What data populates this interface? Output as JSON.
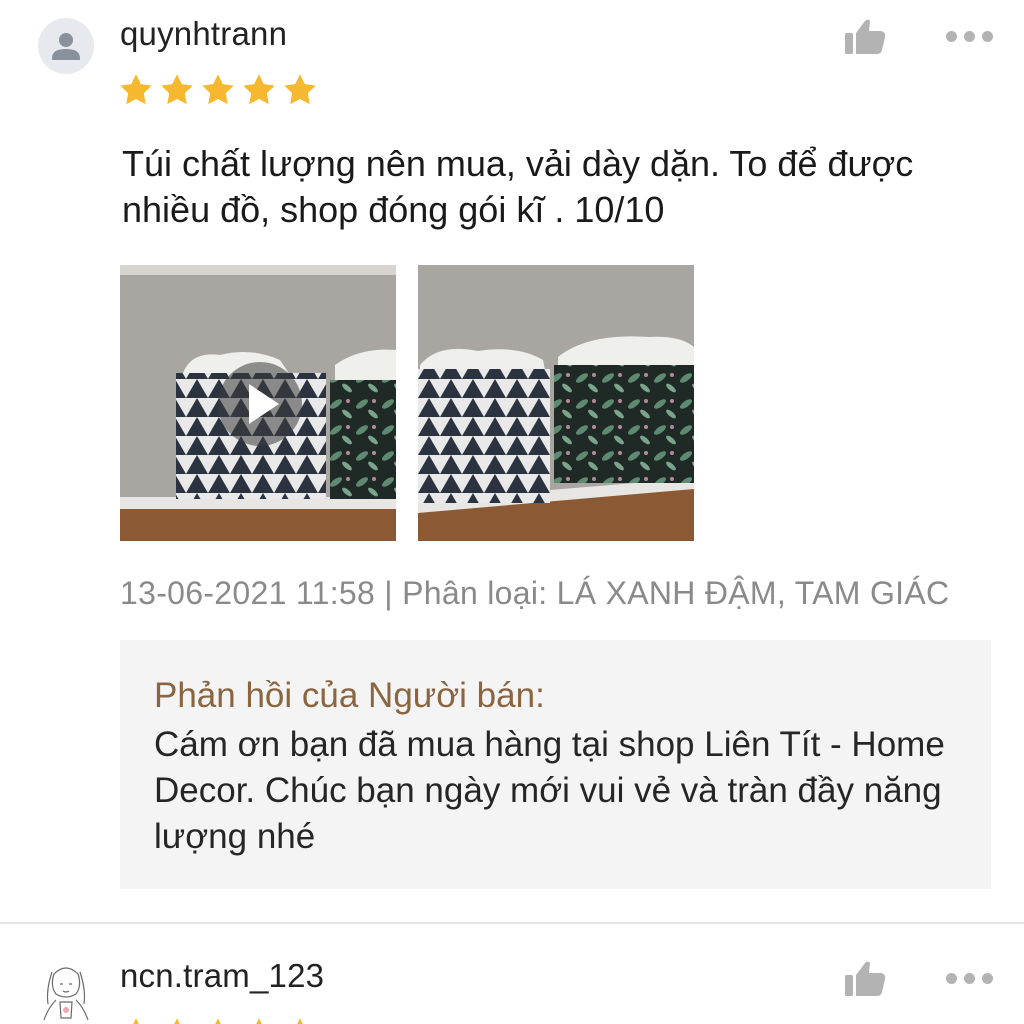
{
  "reviews": [
    {
      "username": "quynhtrann",
      "avatar_icon": "default-user-icon",
      "rating": 5,
      "text": "Túi chất lượng nên mua, vải dày dặn. To để được nhiều đồ, shop đóng gói kĩ . 10/10",
      "media": [
        {
          "type": "video",
          "icon": "play-icon"
        },
        {
          "type": "image"
        }
      ],
      "date": "13-06-2021 11:58",
      "separator": "|",
      "variant_label": "Phân loại:",
      "variant_value": "LÁ XANH ĐẬM, TAM GIÁC",
      "seller_reply": {
        "title": "Phản hồi của Người bán:",
        "body": "Cám ơn bạn đã mua hàng tại shop Liên Tít - Home Decor. Chúc bạn ngày mới vui vẻ và tràn đầy năng lượng nhé"
      }
    },
    {
      "username": "ncn.tram_123",
      "avatar_icon": "sketch-avatar",
      "rating": 5
    }
  ],
  "icons": {
    "like": "thumbs-up-icon",
    "more": "more-options-icon",
    "star": "star-icon"
  },
  "colors": {
    "star": "#F5B82E",
    "icon_gray": "#B3B3B3",
    "meta_text": "#8A8A8A",
    "reply_title": "#8A6540",
    "reply_bg": "#F4F4F4"
  }
}
